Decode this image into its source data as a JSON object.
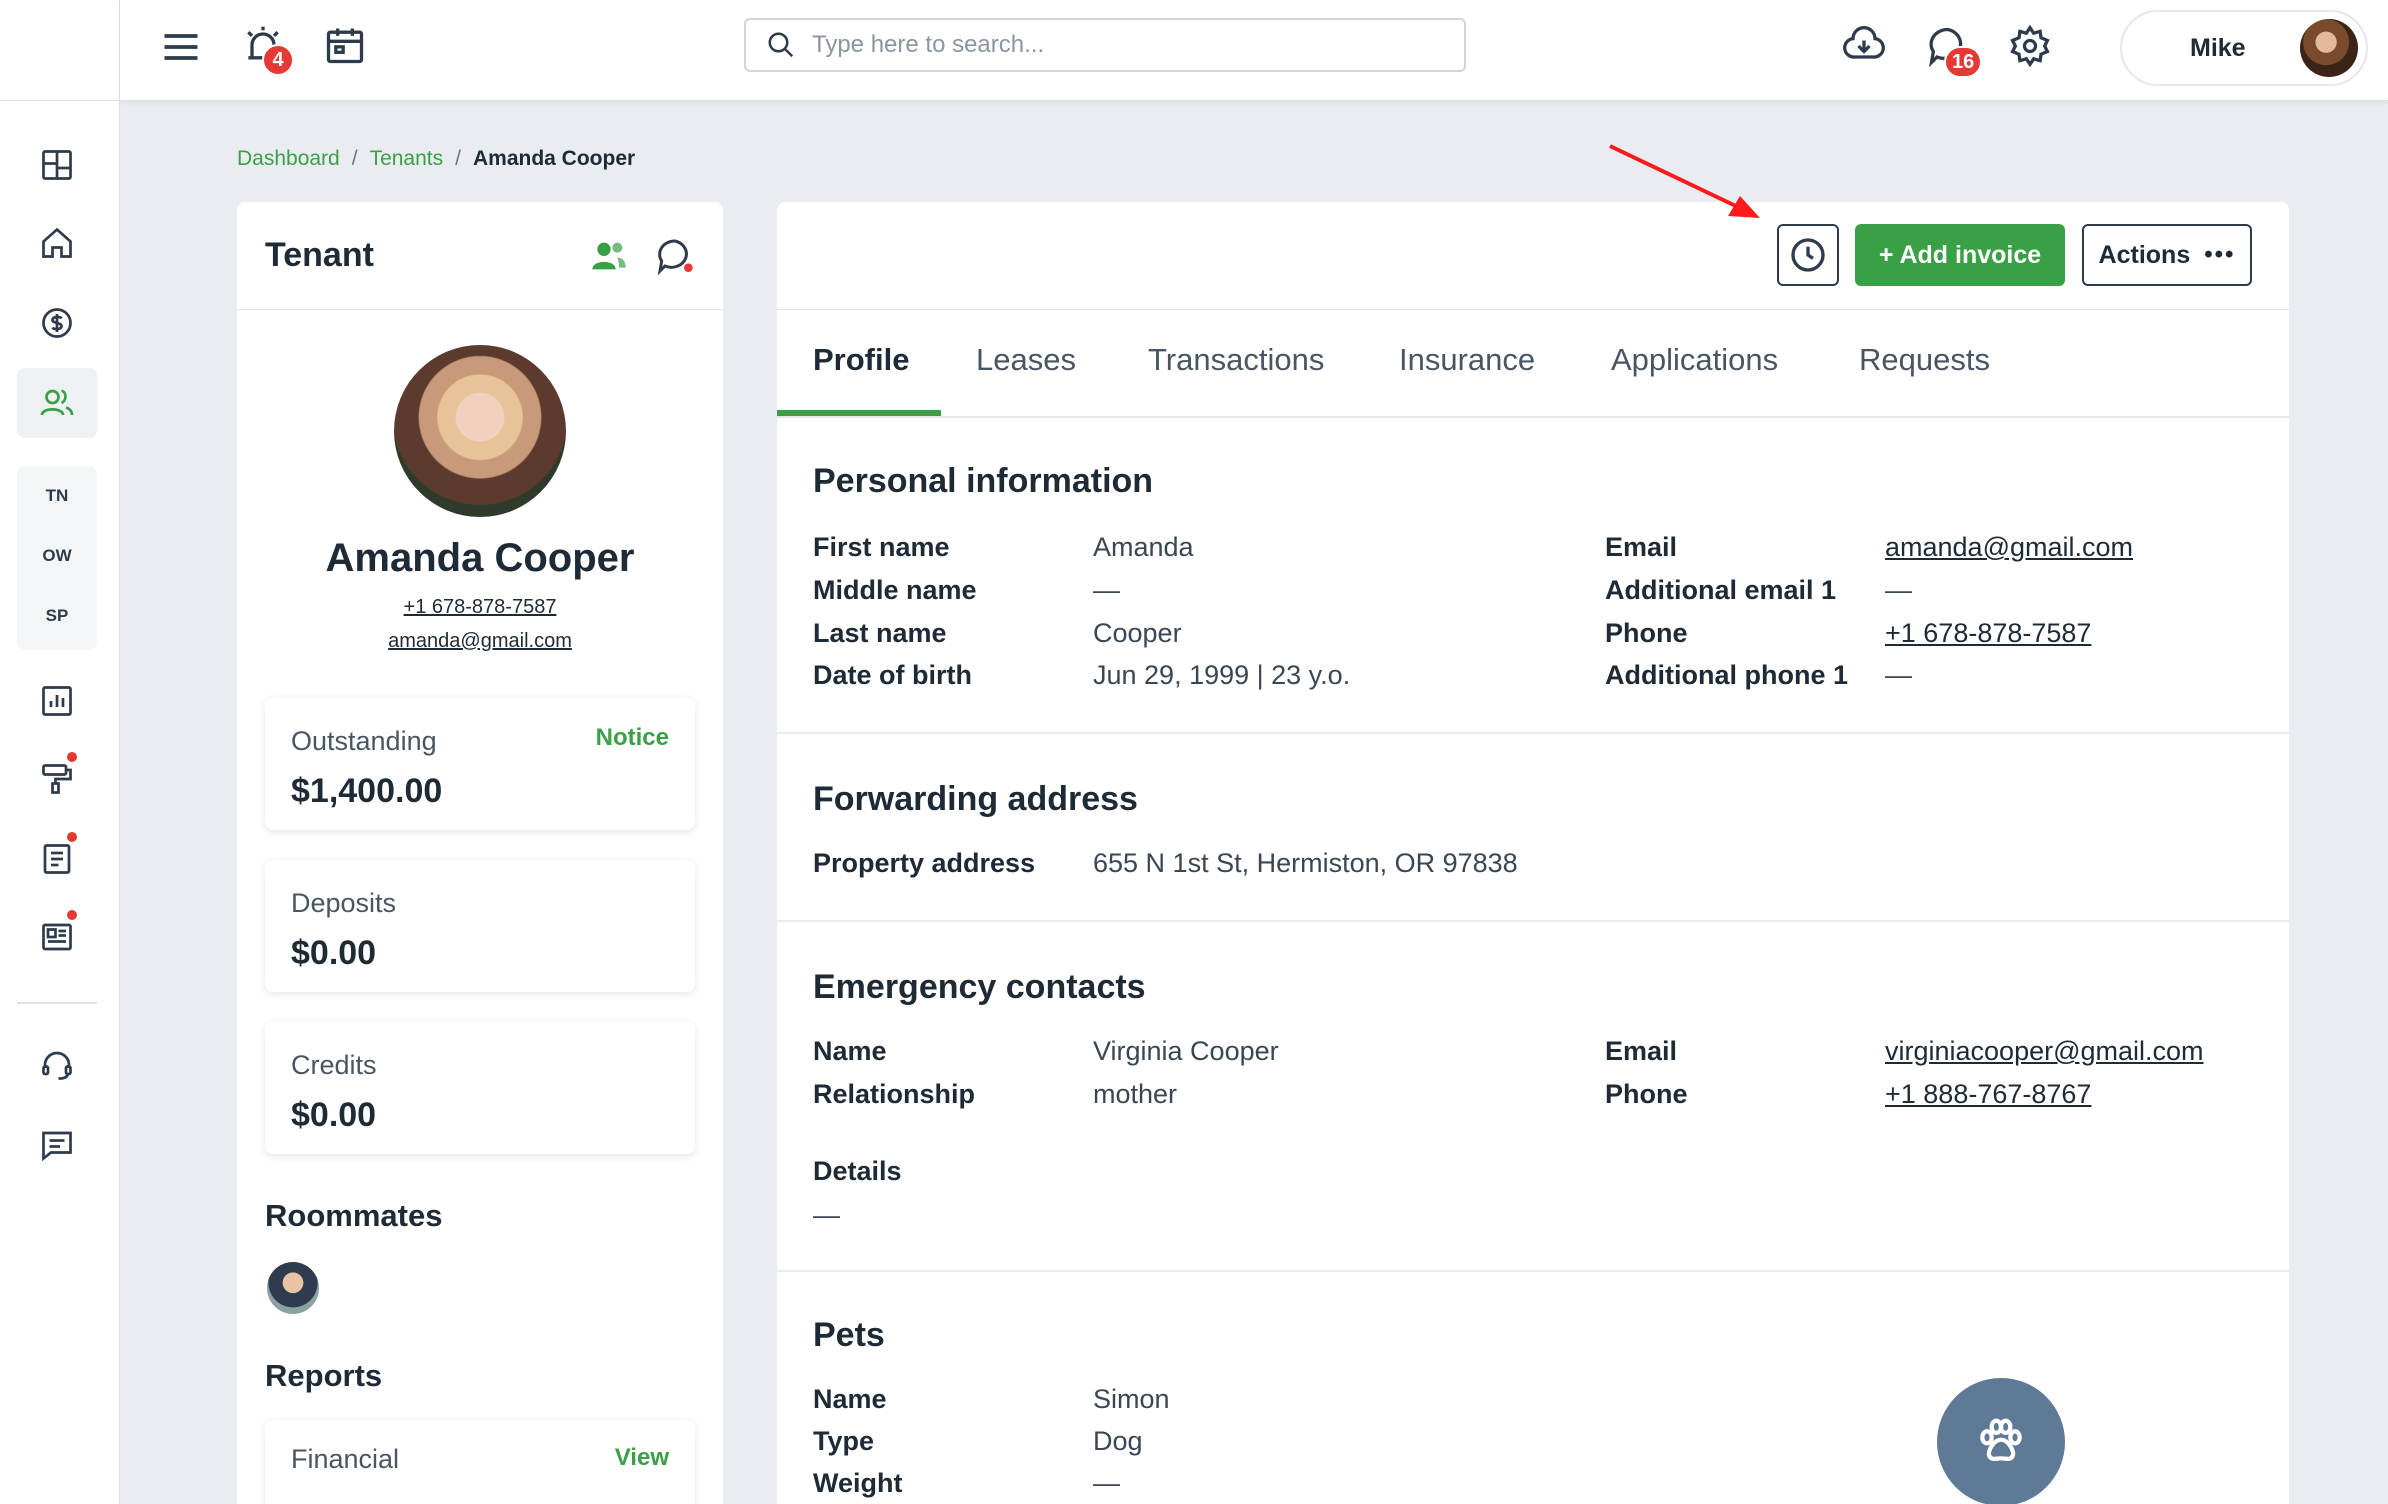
{
  "topbar": {
    "alerts_badge": "4",
    "messages_badge": "16",
    "search_placeholder": "Type here to search...",
    "user_name": "Mike"
  },
  "rail": {
    "abbreviations": [
      "TN",
      "OW",
      "SP"
    ]
  },
  "breadcrumb": {
    "items": [
      "Dashboard",
      "Tenants"
    ],
    "separator": "/",
    "current": "Amanda Cooper"
  },
  "tenant": {
    "card_title": "Tenant",
    "name": "Amanda Cooper",
    "phone": "+1 678-878-7587",
    "email": "amanda@gmail.com",
    "outstanding": {
      "label": "Outstanding",
      "value": "$1,400.00",
      "link": "Notice"
    },
    "deposits": {
      "label": "Deposits",
      "value": "$0.00"
    },
    "credits": {
      "label": "Credits",
      "value": "$0.00"
    },
    "roommates_title": "Roommates",
    "reports_title": "Reports",
    "financial": {
      "label": "Financial",
      "link": "View"
    }
  },
  "main": {
    "add_invoice_label": "+ Add invoice",
    "actions_label": "Actions",
    "actions_dots": "•••",
    "tabs": [
      "Profile",
      "Leases",
      "Transactions",
      "Insurance",
      "Applications",
      "Requests"
    ],
    "active_tab": "Profile",
    "personal": {
      "title": "Personal information",
      "first_name_label": "First name",
      "first_name": "Amanda",
      "middle_name_label": "Middle name",
      "middle_name": "—",
      "last_name_label": "Last name",
      "last_name": "Cooper",
      "dob_label": "Date of birth",
      "dob": "Jun 29, 1999 | 23 y.o.",
      "email_label": "Email",
      "email": "amanda@gmail.com",
      "add_email_label": "Additional email 1",
      "add_email": "—",
      "phone_label": "Phone",
      "phone": "+1 678-878-7587",
      "add_phone_label": "Additional phone 1",
      "add_phone": "—"
    },
    "forwarding": {
      "title": "Forwarding address",
      "property_label": "Property address",
      "property": "655 N 1st St, Hermiston, OR 97838"
    },
    "emergency": {
      "title": "Emergency contacts",
      "name_label": "Name",
      "name": "Virginia Cooper",
      "relationship_label": "Relationship",
      "relationship": "mother",
      "email_label": "Email",
      "email": "virginiacooper@gmail.com",
      "phone_label": "Phone",
      "phone": "+1 888-767-8767",
      "details_label": "Details",
      "details": "—"
    },
    "pets": {
      "title": "Pets",
      "name_label": "Name",
      "name": "Simon",
      "type_label": "Type",
      "type": "Dog",
      "weight_label": "Weight",
      "weight": "—"
    }
  },
  "colors": {
    "accent_green": "#3aa045",
    "badge_red": "#e53935",
    "annotation_arrow": "#ff1a1a",
    "paw_button": "#5f7a97"
  }
}
